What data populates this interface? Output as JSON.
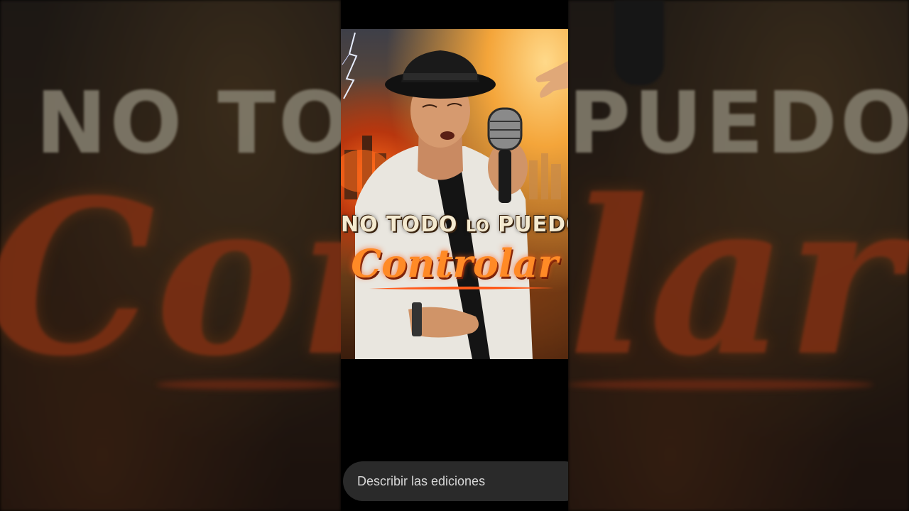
{
  "poster": {
    "title_line1_a": "NO TODO ",
    "title_line1_b": "LO",
    "title_line1_c": " PUEDO",
    "title_line2": "Controlar"
  },
  "backdrop": {
    "left_title": "NO TOD",
    "right_title": "PUEDO",
    "left_script": "Con",
    "right_script": "lar"
  },
  "edit_bar": {
    "placeholder": "Describir las ediciones"
  },
  "colors": {
    "script_orange": "#ff8a26",
    "title_cream": "#f4ead0",
    "edit_bar_bg": "#2a2a2a"
  }
}
